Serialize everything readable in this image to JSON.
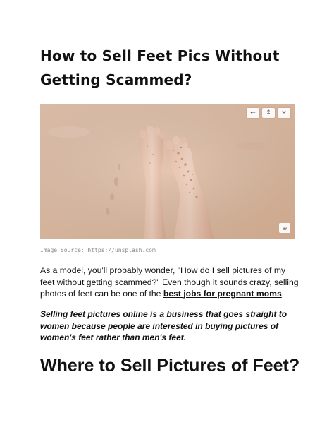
{
  "article": {
    "title": "How to Sell Feet Pics Without Getting Scammed?",
    "image": {
      "alt": "Feet in the sand",
      "controls": {
        "back": "←",
        "expand": "↕",
        "close": "×",
        "zoom": "⊕"
      }
    },
    "caption": "Image Source: https://unsplash.com",
    "intro_before_link": "As a model, you'll probably wonder, \"How do I sell pictures of my feet without getting scammed?\" Even though it sounds crazy, selling photos of feet can be one of the ",
    "intro_link": "best jobs for pregnant moms",
    "intro_after_link": ".",
    "emphasis": "Selling feet pictures online is a business that goes straight to women because people are interested in buying pictures of women's feet rather than men's feet.",
    "section_heading": "Where to Sell Pictures of Feet?"
  }
}
